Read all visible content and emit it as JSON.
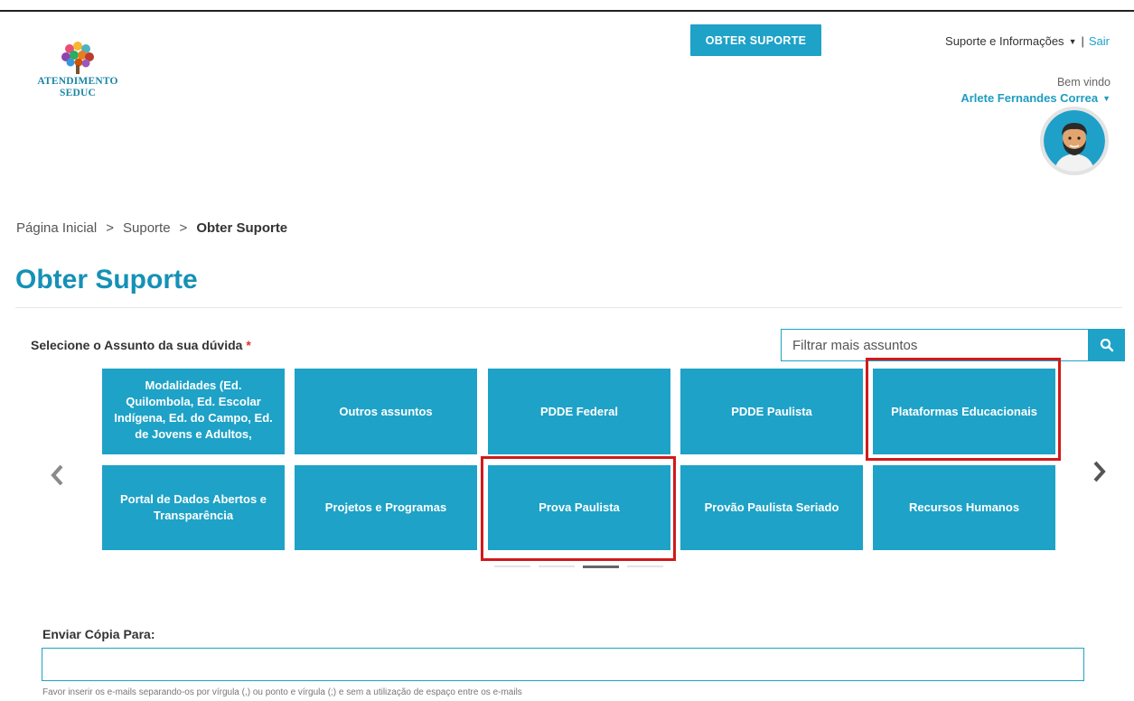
{
  "logo": {
    "line1": "ATENDIMENTO",
    "line2": "SEDUC"
  },
  "header": {
    "support_button": "OBTER SUPORTE",
    "nav_menu_label": "Suporte e Informações",
    "nav_separator": "|",
    "logout_label": "Sair",
    "welcome": "Bem vindo",
    "username": "Arlete Fernandes Correa"
  },
  "breadcrumb": {
    "items": [
      "Página Inicial",
      "Suporte",
      "Obter Suporte"
    ],
    "separator": ">"
  },
  "page": {
    "title": "Obter Suporte",
    "subject_label": "Selecione o Assunto da sua dúvida",
    "required_mark": "*"
  },
  "filter": {
    "placeholder": "Filtrar mais assuntos"
  },
  "tiles": [
    {
      "label": "Modalidades (Ed. Quilombola, Ed. Escolar Indígena, Ed. do Campo, Ed. de Jovens e Adultos,"
    },
    {
      "label": "Outros assuntos"
    },
    {
      "label": "PDDE Federal"
    },
    {
      "label": "PDDE Paulista"
    },
    {
      "label": "Plataformas Educacionais",
      "highlighted": true
    },
    {
      "label": "Portal de Dados Abertos e Transparência"
    },
    {
      "label": "Projetos e Programas"
    },
    {
      "label": "Prova Paulista",
      "highlighted": true
    },
    {
      "label": "Provão Paulista Seriado"
    },
    {
      "label": "Recursos Humanos"
    }
  ],
  "carousel": {
    "page_count": 4,
    "active_page": 3
  },
  "copy_section": {
    "label": "Enviar Cópia Para:",
    "value": "",
    "help": "Favor inserir os e-mails separando-os por vírgula (,) ou ponto e vírgula (;) e sem a utilização de espaço entre os e-mails"
  },
  "colors": {
    "accent": "#1ea2c7",
    "title": "#1591b6",
    "highlight": "#d11a1a"
  },
  "icons": [
    "search-icon",
    "chevron-left-icon",
    "chevron-right-icon",
    "caret-down-icon",
    "avatar"
  ]
}
